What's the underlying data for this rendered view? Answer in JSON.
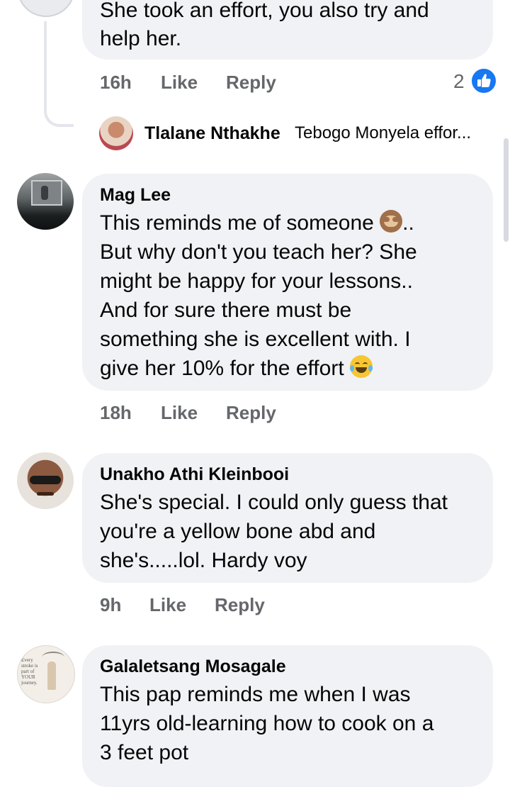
{
  "comment_top": {
    "lines": [
      "She took an effort, you also try and",
      "help her."
    ],
    "time": "16h",
    "like_label": "Like",
    "reply_label": "Reply",
    "reaction_count": "2",
    "reaction_icon": "thumbs-up-icon",
    "reaction_color": "#1877f2"
  },
  "reply_preview": {
    "author": "Tlalane Nthakhe",
    "text": "Tebogo Monyela effor..."
  },
  "comments": [
    {
      "author": "Mag Lee",
      "lines": [
        "This reminds me of someone",
        "But why don't you teach her? She",
        "might be happy for your lessons..",
        "And for sure there must be",
        "something she is excellent with. I",
        "give her 10% for the effort"
      ],
      "line1_suffix": "..",
      "emoji1": "see-no-evil-monkey-icon",
      "emoji2": "tears-of-joy-icon",
      "time": "18h",
      "like_label": "Like",
      "reply_label": "Reply"
    },
    {
      "author": "Unakho Athi Kleinbooi",
      "lines": [
        "She's special. I could only guess that",
        "you're a yellow bone abd and",
        "she's.....lol. Hardy voy"
      ],
      "time": "9h",
      "like_label": "Like",
      "reply_label": "Reply"
    },
    {
      "author": "Galaletsang Mosagale",
      "lines": [
        "This pap reminds me when I was",
        "11yrs old-learning how to cook  on a",
        "3 feet pot"
      ],
      "avatar_text": [
        "Every",
        "stroke is",
        "part of",
        "YOUR",
        "journey."
      ]
    }
  ],
  "colors": {
    "bubble": "#f0f2f5",
    "meta_text": "#65676b",
    "body_text": "#050505",
    "thread_line": "#e4e6eb"
  }
}
